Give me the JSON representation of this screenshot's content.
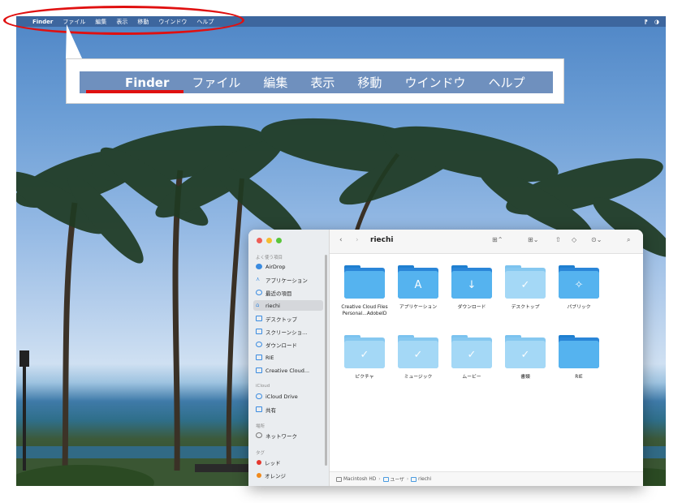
{
  "menubar": {
    "apple": "",
    "items": [
      "Finder",
      "ファイル",
      "編集",
      "表示",
      "移動",
      "ウインドウ",
      "ヘルプ"
    ],
    "right_icons": [
      "status-icon",
      "user-icon"
    ]
  },
  "callout": {
    "apple": "",
    "items": [
      "Finder",
      "ファイル",
      "編集",
      "表示",
      "移動",
      "ウインドウ",
      "ヘルプ"
    ]
  },
  "finder": {
    "title": "riechi",
    "sidebar": {
      "favorites_label": "よく使う項目",
      "favorites": [
        "AirDrop",
        "アプリケーション",
        "最近の項目",
        "riechi",
        "デスクトップ",
        "スクリーンショ...",
        "ダウンロード",
        "RIE",
        "Creative Cloud..."
      ],
      "icloud_label": "iCloud",
      "icloud": [
        "iCloud Drive",
        "共有"
      ],
      "locations_label": "場所",
      "locations": [
        "ネットワーク"
      ],
      "tags_label": "タグ",
      "tags": [
        {
          "name": "レッド",
          "color": "#e5372e"
        },
        {
          "name": "オレンジ",
          "color": "#f08a1c"
        }
      ]
    },
    "items": [
      {
        "label": "Creative Cloud Files Personal...AdobeID",
        "glyph": "",
        "style": "dark"
      },
      {
        "label": "アプリケーション",
        "glyph": "A",
        "style": "dark"
      },
      {
        "label": "ダウンロード",
        "glyph": "↓",
        "style": "dark"
      },
      {
        "label": "デスクトップ",
        "glyph": "✓",
        "style": "light"
      },
      {
        "label": "パブリック",
        "glyph": "✧",
        "style": "dark"
      },
      {
        "label": "ピクチャ",
        "glyph": "✓",
        "style": "light"
      },
      {
        "label": "ミュージック",
        "glyph": "✓",
        "style": "light"
      },
      {
        "label": "ムービー",
        "glyph": "✓",
        "style": "light"
      },
      {
        "label": "書類",
        "glyph": "✓",
        "style": "light"
      },
      {
        "label": "RIE",
        "glyph": "",
        "style": "dark"
      }
    ],
    "path": [
      "Macintosh HD",
      "ユーザ",
      "riechi"
    ]
  }
}
